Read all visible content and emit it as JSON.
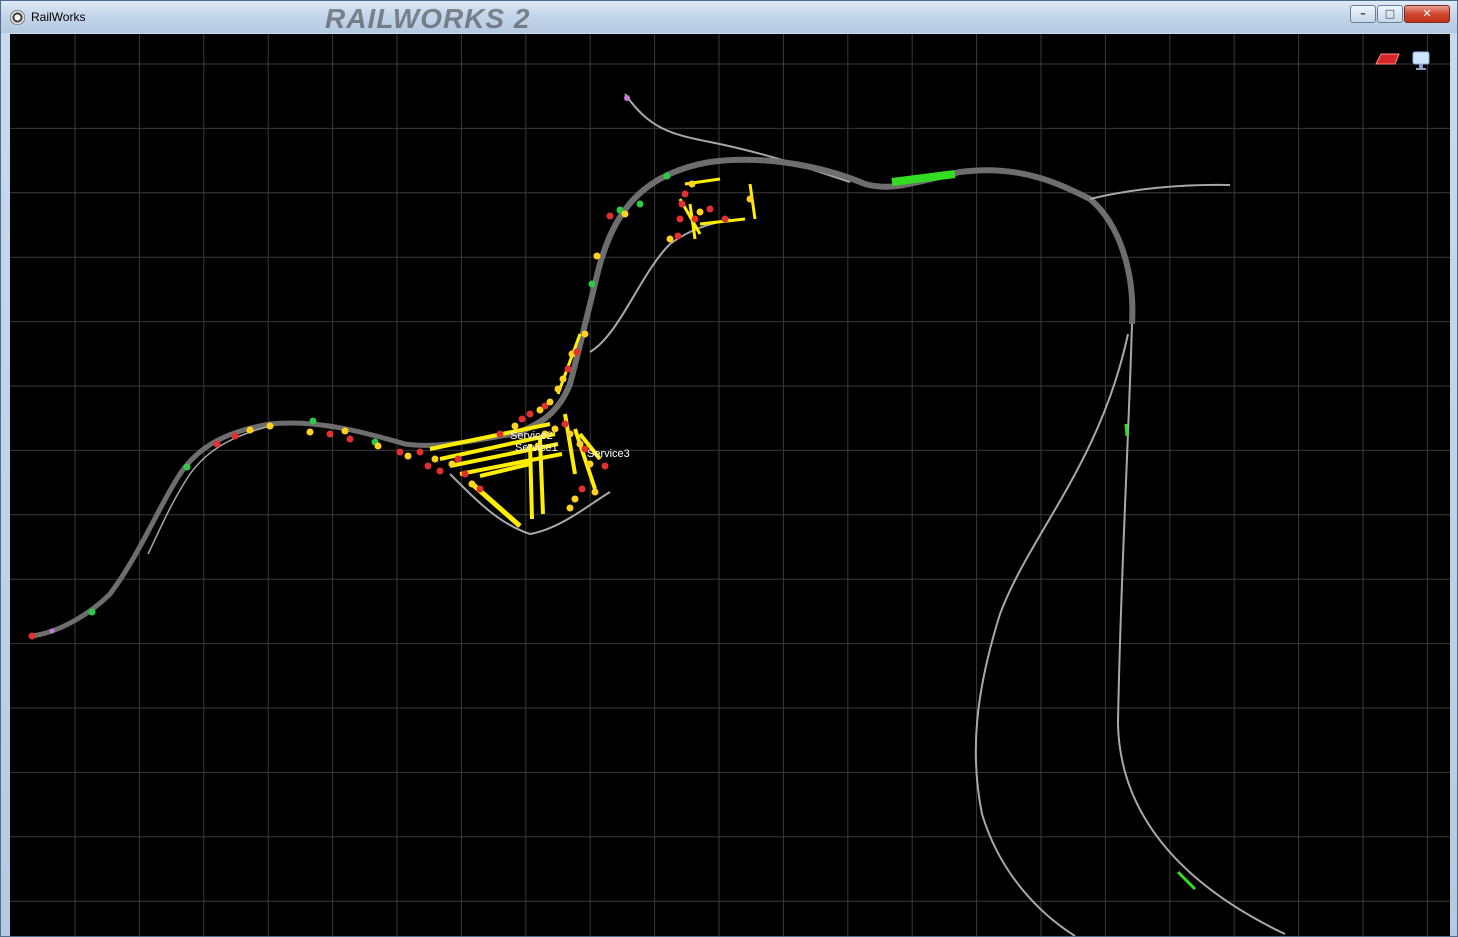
{
  "window": {
    "title": "RailWorks",
    "background_logo": "RAILWORKS 2",
    "controls": {
      "minimize": "–",
      "maximize": "□",
      "close": "✕"
    }
  },
  "map": {
    "background_color": "#000000",
    "grid_color": "#3a3a3a",
    "track_color": "#a8a8a8",
    "double_track_color": "#6e6e6e",
    "yard_track_color": "#ffee00",
    "occupied_section_color": "#33dd22",
    "signal_colors": {
      "red": "#e03030",
      "yellow": "#ffd21f",
      "green": "#2ec84a"
    },
    "service_labels": [
      "Service2",
      "Service1",
      "Service3"
    ]
  },
  "toolbar": {
    "icons": [
      "red-shape-icon",
      "monitor-icon"
    ],
    "accent": "#d8252a"
  }
}
